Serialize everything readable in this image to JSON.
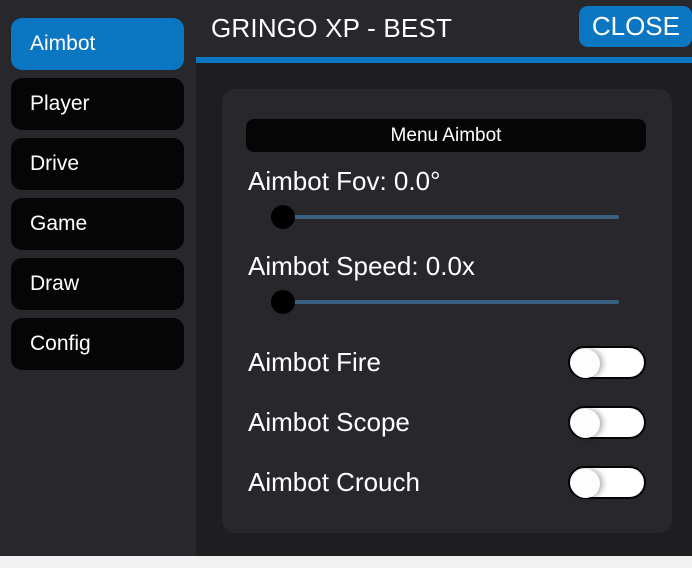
{
  "window": {
    "background": "#1e1d20",
    "panel_color": "#28272c",
    "accent_color": "#0b77c2"
  },
  "header": {
    "title": "GRINGO XP - BEST",
    "close_label": "CLOSE"
  },
  "sidebar": {
    "items": [
      {
        "label": "Aimbot",
        "active": true
      },
      {
        "label": "Player",
        "active": false
      },
      {
        "label": "Drive",
        "active": false
      },
      {
        "label": "Game",
        "active": false
      },
      {
        "label": "Draw",
        "active": false
      },
      {
        "label": "Config",
        "active": false
      }
    ]
  },
  "main": {
    "section_title": "Menu Aimbot",
    "sliders": [
      {
        "label": "Aimbot Fov: 0.0°",
        "value": 0.0,
        "unit": "°",
        "percent": 0
      },
      {
        "label": "Aimbot Speed: 0.0x",
        "value": 0.0,
        "unit": "x",
        "percent": 0
      }
    ],
    "toggles": [
      {
        "label": "Aimbot Fire",
        "state": "off"
      },
      {
        "label": "Aimbot Scope",
        "state": "off"
      },
      {
        "label": "Aimbot Crouch",
        "state": "off"
      }
    ]
  }
}
